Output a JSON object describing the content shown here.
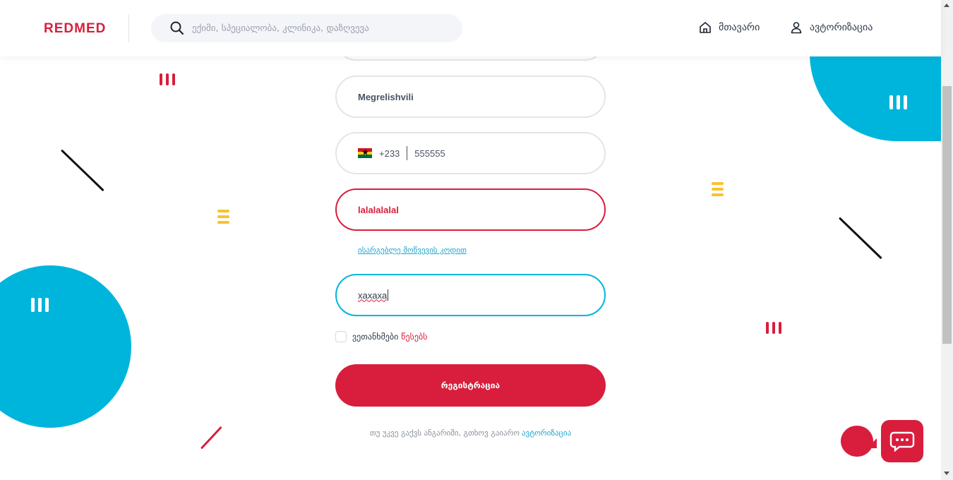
{
  "header": {
    "logo": "REDMED",
    "search_placeholder": "ექიმი, სპეციალობა, კლინიკა, დაზღვევა",
    "nav_home": "მთავარი",
    "nav_auth": "ავტორიზაცია"
  },
  "form": {
    "last_name": "Megrelishvili",
    "phone_code": "+233",
    "phone_number": "555555",
    "error_field_value": "lalalalalal",
    "invite_code_link": "ისარგებლე მოწვევის კოდით",
    "invite_code_value": "xaxaxa",
    "terms_prefix": "ვეთანხმები",
    "terms_link": "წესებს",
    "register_button": "რეგისტრაცია",
    "login_note": "თუ უკვე გაქვს ანგარიში, გთხოვ გაიარო",
    "login_link": "ავტორიზაცია"
  },
  "colors": {
    "brand_red": "#d81e3c",
    "accent_blue": "#00b5dc",
    "accent_yellow": "#f9c22e"
  },
  "icons": {
    "search": "search-icon",
    "home": "home-icon",
    "user": "user-icon",
    "flag": "ghana-flag-icon",
    "chat": "chat-icon"
  }
}
